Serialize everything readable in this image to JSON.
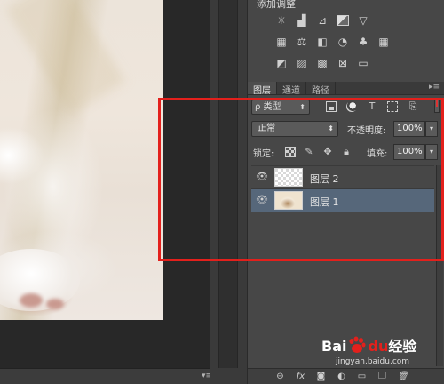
{
  "adjustments": {
    "title": "添加调整",
    "rows": [
      [
        "brightness-icon",
        "levels-icon",
        "curves-icon",
        "exposure-icon",
        "vibrance-icon"
      ],
      [
        "hue-saturation-icon",
        "color-balance-icon",
        "black-white-icon",
        "photo-filter-icon",
        "channel-mixer-icon",
        "color-lookup-icon"
      ],
      [
        "invert-icon",
        "posterize-icon",
        "threshold-icon",
        "selective-color-icon",
        "gradient-map-icon"
      ]
    ]
  },
  "tabs": [
    "图层",
    "通道",
    "路径"
  ],
  "filter": {
    "label": "ρ 类型",
    "icons": [
      "pixel-layer-filter-icon",
      "adjustment-layer-filter-icon",
      "type-layer-filter-icon",
      "shape-layer-filter-icon",
      "smart-object-filter-icon"
    ],
    "type_glyph": "T"
  },
  "blend": {
    "mode": "正常",
    "opacity_label": "不透明度:",
    "opacity_value": "100%"
  },
  "lock": {
    "label": "锁定:",
    "fill_label": "填充:",
    "fill_value": "100%"
  },
  "layers": [
    {
      "name": "图层 2",
      "visible": true,
      "selected": false,
      "thumbnail": "transparent"
    },
    {
      "name": "图层 1",
      "visible": true,
      "selected": true,
      "thumbnail": "photo"
    }
  ],
  "bottom_toolbar": [
    "link-layers-icon",
    "fx-icon",
    "mask-icon",
    "adjustment-icon",
    "group-icon",
    "new-layer-icon",
    "trash-icon"
  ],
  "bottom_labels": {
    "fx": "fx"
  },
  "watermark": {
    "brand_a": "Bai",
    "brand_b": "du",
    "brand_c": "经验",
    "url": "jingyan.baidu.com"
  },
  "colors": {
    "highlight_frame": "#e3201c",
    "selected_layer": "#56677a",
    "panel_bg": "#474747"
  }
}
